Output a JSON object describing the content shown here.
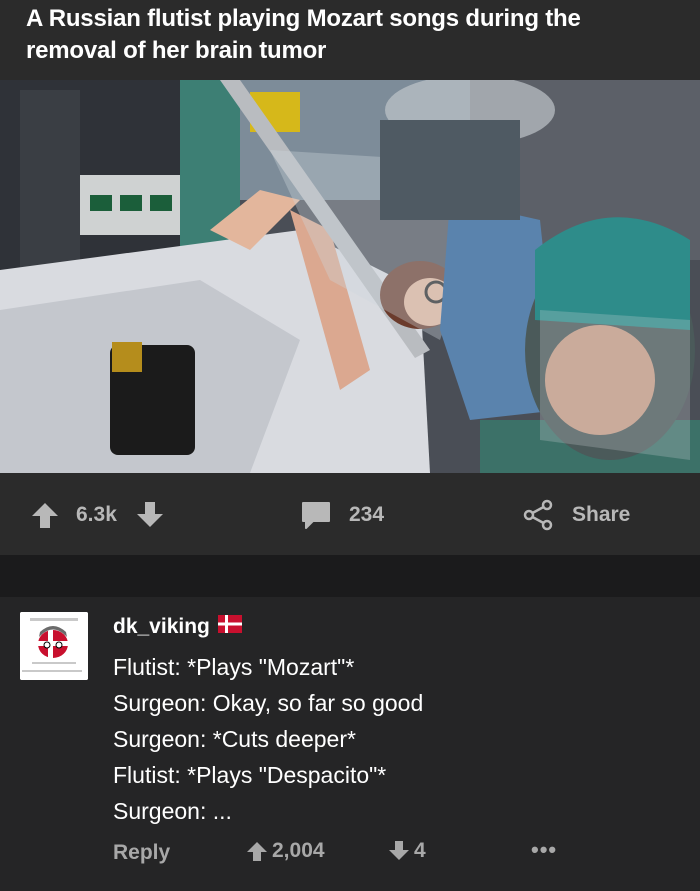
{
  "post": {
    "title": "A Russian flutist playing Mozart songs during the removal of her brain tumor",
    "image_description_icon": "surgery-photo"
  },
  "actions": {
    "upvotes": "6.3k",
    "comments": "234",
    "share_label": "Share"
  },
  "comment": {
    "username": "dk_viking",
    "flag_icon": "denmark-flag-icon",
    "lines": [
      "Flutist: *Plays \"Mozart\"*",
      "Surgeon: Okay, so far so good",
      "Surgeon: *Cuts deeper*",
      "Flutist: *Plays \"Despacito\"*",
      "Surgeon: ..."
    ],
    "reply_label": "Reply",
    "upvotes": "2,004",
    "downvotes": "4",
    "more_label": "•••"
  },
  "colors": {
    "header_bg": "#2b2b2b",
    "page_bg": "#1b1b1c",
    "comment_bg": "#252526",
    "muted_text": "#b8b8b8"
  }
}
